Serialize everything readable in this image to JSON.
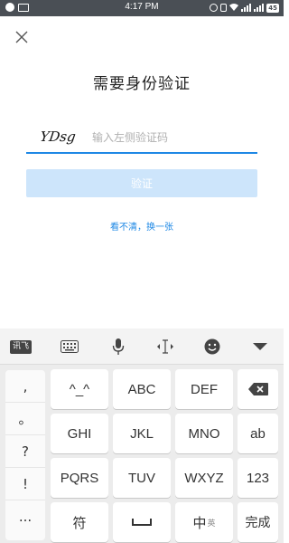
{
  "status_bar": {
    "time": "4:17 PM",
    "battery": "45"
  },
  "page": {
    "title": "需要身份验证",
    "captcha_text": "YDsg",
    "input_placeholder": "输入左侧验证码",
    "input_value": "",
    "verify_label": "验证",
    "refresh_label": "看不清，换一张"
  },
  "keyboard": {
    "toolbar": {
      "logo_label": "讯飞",
      "icons": [
        "keyboard-icon",
        "microphone-icon",
        "cursor-move-icon",
        "emoji-icon",
        "collapse-icon"
      ]
    },
    "side_keys": [
      ",",
      "。",
      "?",
      "!",
      "..."
    ],
    "rows": [
      [
        "^_^",
        "ABC",
        "DEF",
        "⌫"
      ],
      [
        "GHI",
        "JKL",
        "MNO",
        "ab"
      ],
      [
        "PQRS",
        "TUV",
        "WXYZ",
        "123"
      ],
      [
        "符",
        "␣",
        "中",
        "完成"
      ]
    ],
    "lang_sub": "英"
  },
  "colors": {
    "accent": "#1e88e5",
    "button_disabled": "#cde5fb",
    "status_bar": "#4a4f55",
    "keyboard_bg": "#ececec"
  }
}
